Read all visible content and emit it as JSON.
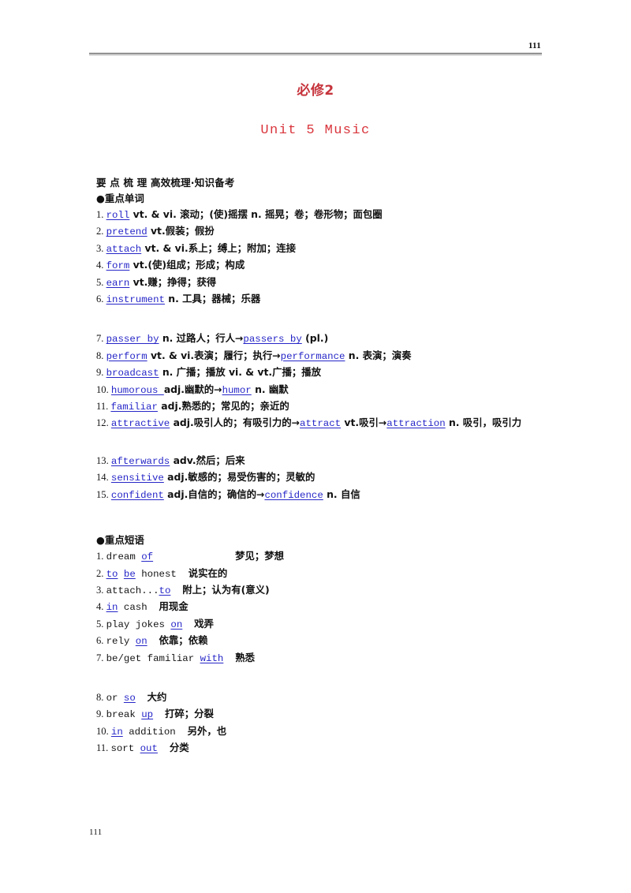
{
  "header": {
    "page_number": "111"
  },
  "titles": {
    "book": "必修2",
    "unit": "Unit 5  Music"
  },
  "sections": {
    "overview_heading": "要 点 梳 理 高效梳理·知识备考",
    "words_heading": "●重点单词",
    "phrases_heading": "●重点短语"
  },
  "words_block_1": [
    {
      "num": "1.",
      "key": "roll",
      "rest": " vt. & vi. 滚动；(使)摇摆 n. 摇晃；卷；卷形物；面包圈"
    },
    {
      "num": "2.",
      "key": "pretend",
      "rest": " vt.假装；假扮"
    },
    {
      "num": "3.",
      "key": "attach",
      "rest": " vt. & vi.系上；缚上；附加；连接"
    },
    {
      "num": "4.",
      "key": "form",
      "rest": " vt.(使)组成；形成；构成"
    },
    {
      "num": "5.",
      "key": "earn",
      "rest": " vt.赚；挣得；获得"
    },
    {
      "num": "6.",
      "key": "instrument",
      "rest": " n. 工具；器械；乐器"
    }
  ],
  "words_block_2": [
    {
      "num": "7.",
      "key": "passer  by",
      "mid": " n. 过路人；行人→",
      "key2": "passers  by",
      "tail": " (pl.)"
    },
    {
      "num": "8.",
      "key": "perform",
      "mid": " vt. & vi.表演；履行；执行→",
      "key2": "performance",
      "tail": " n. 表演；演奏"
    },
    {
      "num": "9.",
      "key": "broadcast",
      "mid": " n. 广播；播放 vi. & vt.广播；播放",
      "key2": "",
      "tail": ""
    },
    {
      "num": "10.",
      "key": "humorous ",
      "mid": " adj.幽默的→",
      "key2": "humor",
      "tail": " n. 幽默"
    },
    {
      "num": "11.",
      "key": "familiar",
      "mid": " adj.熟悉的；常见的；亲近的",
      "key2": "",
      "tail": ""
    },
    {
      "num": "12.",
      "key": "attractive",
      "mid": " adj.吸引人的；有吸引力的→",
      "key2": "attract",
      "mid2": " vt.吸引→",
      "key3": "attraction",
      "tail": " n. 吸引，吸引力"
    }
  ],
  "words_block_3": [
    {
      "num": "13.",
      "key": "afterwards",
      "mid": " adv.然后；后来",
      "key2": "",
      "tail": ""
    },
    {
      "num": "14.",
      "key": "sensitive",
      "mid": " adj.敏感的；易受伤害的；灵敏的",
      "key2": "",
      "tail": ""
    },
    {
      "num": "15.",
      "key": "confident",
      "mid": " adj.自信的；确信的→",
      "key2": "confidence",
      "tail": " n. 自信"
    }
  ],
  "phrases_block_1": [
    {
      "num": "1.",
      "pre": "dream ",
      "key": "of",
      "post": "",
      "wide_gap": true,
      "meaning": "梦见；梦想"
    },
    {
      "num": "2.",
      "pre": "",
      "key": "to",
      "key_extra": "be",
      "post": " honest",
      "wide_gap": false,
      "meaning": "说实在的"
    },
    {
      "num": "3.",
      "pre": "attach...",
      "key": "to",
      "post": "",
      "wide_gap": false,
      "meaning": "附上；认为有(意义)"
    },
    {
      "num": "4.",
      "pre": "",
      "key": "in",
      "post": " cash",
      "wide_gap": false,
      "meaning": "用现金"
    },
    {
      "num": "5.",
      "pre": "play jokes ",
      "key": "on",
      "post": "",
      "wide_gap": false,
      "meaning": "戏弄"
    },
    {
      "num": "6.",
      "pre": "rely ",
      "key": "on",
      "post": "",
      "wide_gap": false,
      "meaning": "依靠；依赖"
    },
    {
      "num": "7.",
      "pre": "be/get familiar ",
      "key": "with",
      "post": "",
      "wide_gap": false,
      "meaning": "熟悉"
    }
  ],
  "phrases_block_2": [
    {
      "num": "8.",
      "pre": "or ",
      "key": "so",
      "post": "",
      "meaning": "大约"
    },
    {
      "num": "9.",
      "pre": "break ",
      "key": "up",
      "post": "",
      "meaning": "打碎；分裂"
    },
    {
      "num": "10.",
      "pre": "",
      "key": "in",
      "post": " addition",
      "meaning": "另外，也"
    },
    {
      "num": "11.",
      "pre": "sort ",
      "key": "out",
      "post": "",
      "meaning": "分类"
    }
  ],
  "footer": {
    "page_number": "111"
  },
  "colors": {
    "title_red": "#c6343c",
    "keyword_blue": "#2626c8",
    "rule_gray": "#4a4a4a"
  }
}
